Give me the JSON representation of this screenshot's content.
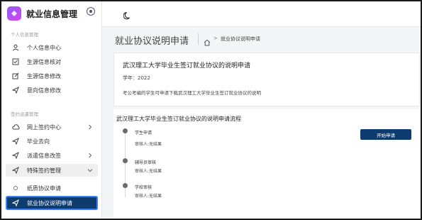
{
  "app": {
    "title": "就业信息管理"
  },
  "sidebar": {
    "sections": [
      {
        "title": "个人信息管理"
      },
      {
        "title": "签约派遣管理"
      }
    ],
    "personal_items": [
      {
        "label": "个人信息中心",
        "icon": "user-icon"
      },
      {
        "label": "生源信息核对",
        "icon": "checklist-icon"
      },
      {
        "label": "生源信息修改",
        "icon": "edit-icon"
      },
      {
        "label": "意向信息修改",
        "icon": "send-icon"
      }
    ],
    "contract_items": [
      {
        "label": "网上签约中心",
        "icon": "cloud-icon"
      },
      {
        "label": "毕业去向",
        "icon": "send-icon"
      },
      {
        "label": "派遣信息改签",
        "icon": "send-icon"
      },
      {
        "label": "特殊签约管理",
        "icon": "send-icon"
      }
    ],
    "sub_items": [
      {
        "label": "纸质协议申请"
      },
      {
        "label": "就业协议说明申请"
      }
    ]
  },
  "header": {
    "page_title": "就业协议说明申请",
    "breadcrumb_current": "就业协议说明申请",
    "breadcrumb_separator": ">"
  },
  "info_card": {
    "title": "武汉理工大学毕业生签订就业协议的说明申请",
    "year": "学年：2022",
    "note": "考公考编的学生可申请下载武汉理工大学毕业生签订就业协议的说明"
  },
  "process": {
    "title": "武汉理工大学毕业生签订就业协议的说明申请流程",
    "steps": [
      {
        "name": "学生申请",
        "reviewer": "审核人:无结果"
      },
      {
        "name": "辅导员审核",
        "reviewer": "审核人:无结果"
      },
      {
        "name": "学校审核",
        "reviewer": "审核人:无结果"
      }
    ],
    "start_button": "开始申请"
  },
  "colors": {
    "primary": "#0f3c6e",
    "active_outline": "#3b82f6",
    "logo_start": "#8b5cf6",
    "logo_end": "#d946ef"
  }
}
